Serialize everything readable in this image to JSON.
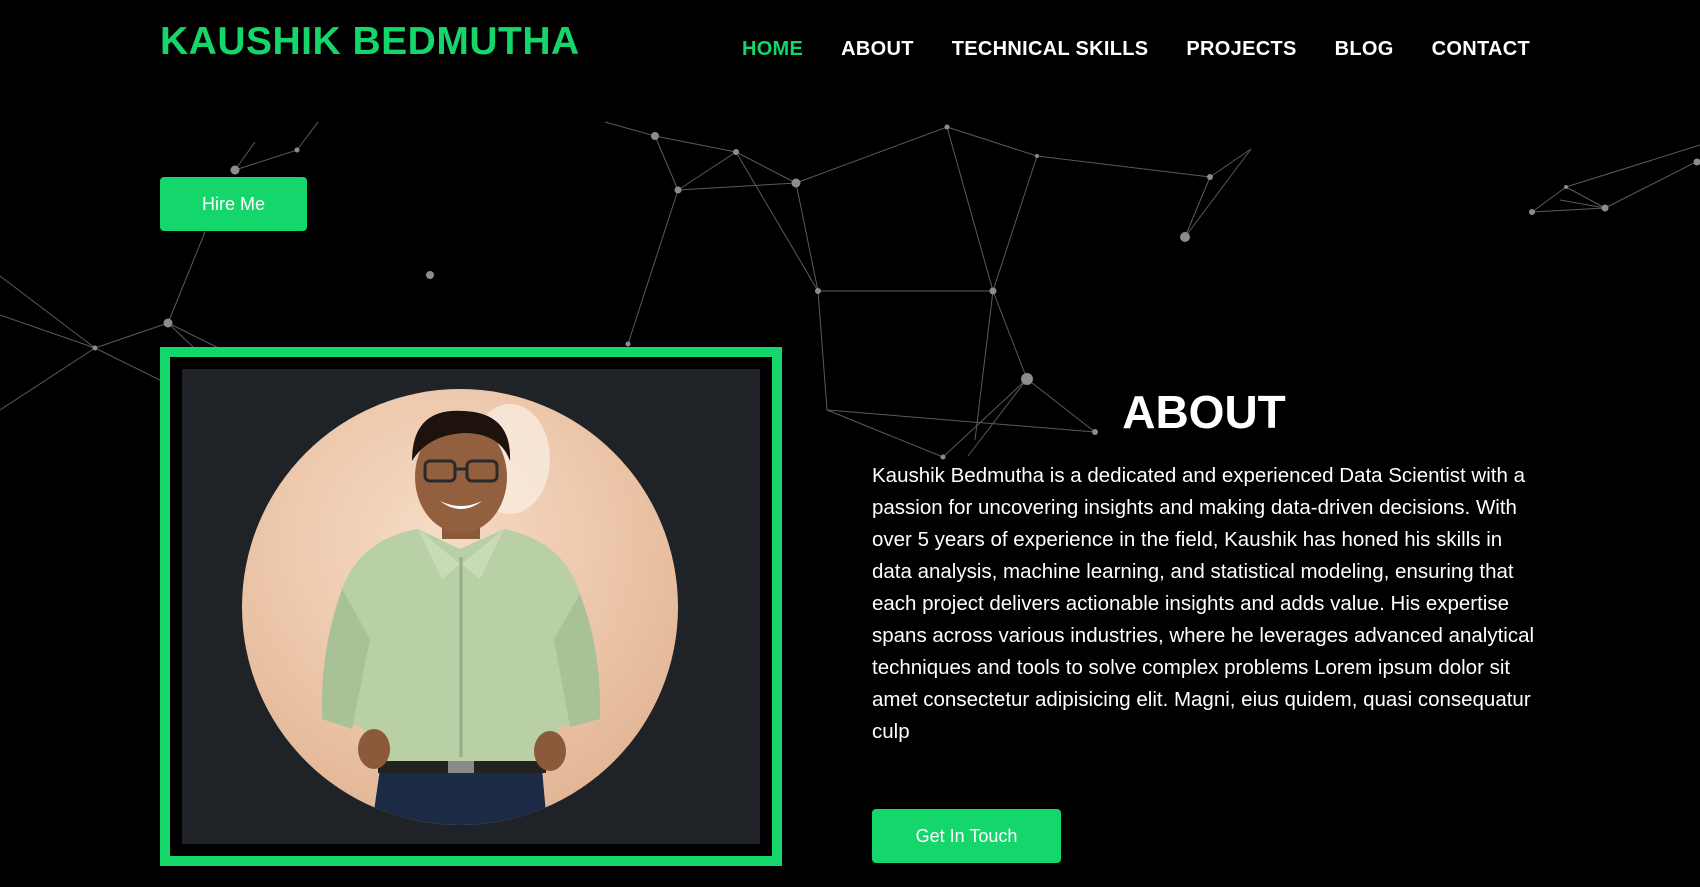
{
  "header": {
    "brand": "KAUSHIK BEDMUTHA",
    "nav": [
      {
        "label": "HOME",
        "active": true
      },
      {
        "label": "ABOUT",
        "active": false
      },
      {
        "label": "TECHNICAL SKILLS",
        "active": false
      },
      {
        "label": "PROJECTS",
        "active": false
      },
      {
        "label": "BLOG",
        "active": false
      },
      {
        "label": "CONTACT",
        "active": false
      }
    ]
  },
  "hero": {
    "hire_label": "Hire Me"
  },
  "about": {
    "title": "ABOUT",
    "text": "Kaushik Bedmutha is a dedicated and experienced Data Scientist with a passion for uncovering insights and making data-driven decisions. With over 5 years of experience in the field, Kaushik has honed his skills in data analysis, machine learning, and statistical modeling, ensuring that each project delivers actionable insights and adds value. His expertise spans across various industries, where he leverages advanced analytical techniques and tools to solve complex problems Lorem ipsum dolor sit amet consectetur adipisicing elit. Magni, eius quidem, quasi consequatur culp",
    "cta_label": "Get In Touch"
  },
  "colors": {
    "accent": "#14d66b",
    "background": "#000000",
    "photo_panel": "#1f2226",
    "text": "#ffffff"
  },
  "icons": {
    "background": "particle-network"
  }
}
